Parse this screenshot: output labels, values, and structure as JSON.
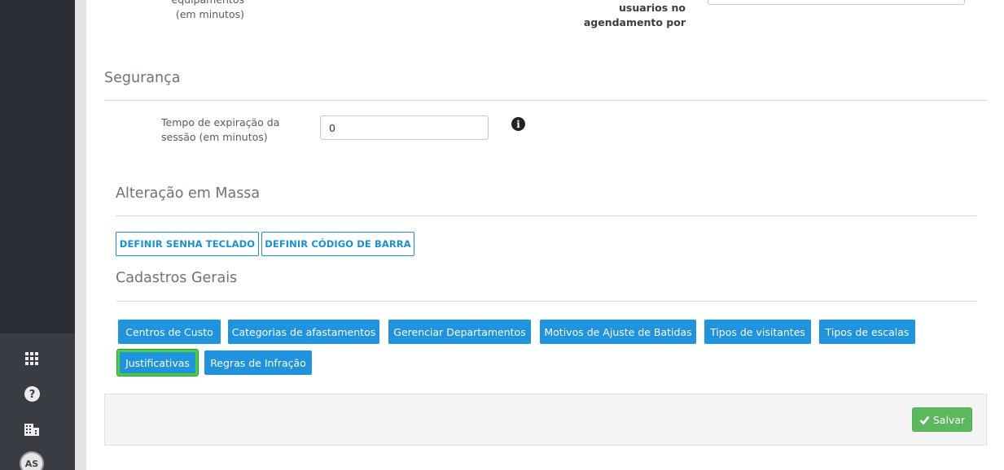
{
  "sidebar": {
    "icons": [
      "apps-grid-icon",
      "help-icon",
      "building-icon"
    ],
    "avatar_initials": "AS"
  },
  "top_fields": {
    "left_label_line1": "equipamentos",
    "left_label_line2": "(em minutos)",
    "right_label_line1": "usuarios no",
    "right_label_line2": "agendamento por"
  },
  "seguranca": {
    "title": "Segurança",
    "session_label_line1": "Tempo de expiração da",
    "session_label_line2": "sessão (em minutos)",
    "session_value": "0"
  },
  "alteracao_massa": {
    "title": "Alteração em Massa",
    "btn_senha": "DEFINIR SENHA TECLADO",
    "btn_codigo": "DEFINIR CÓDIGO DE BARRA"
  },
  "cadastros_gerais": {
    "title": "Cadastros Gerais",
    "buttons": [
      "Centros de Custo",
      "Categorias de afastamentos",
      "Gerenciar Departamentos",
      "Motivos de Ajuste de Batidas",
      "Tipos de visitantes",
      "Tipos de escalas",
      "Justificativas",
      "Regras de Infração"
    ]
  },
  "footer": {
    "save_label": "Salvar"
  },
  "colors": {
    "primary_blue": "#1f93dd",
    "success_green": "#5cb85c",
    "focus_ring": "#4ccf3c",
    "sidebar_bg": "#2b2d34"
  }
}
